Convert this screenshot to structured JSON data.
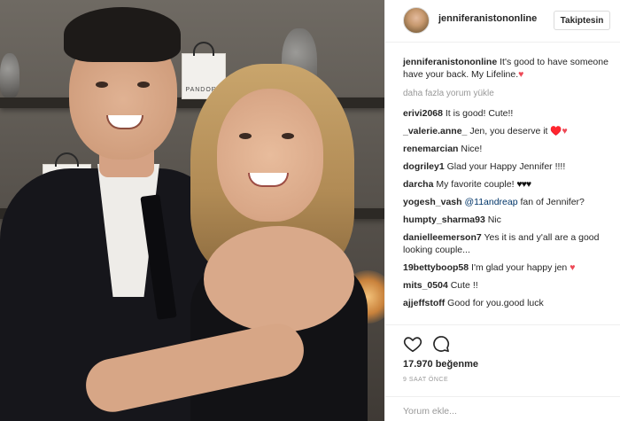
{
  "photo": {
    "alt": "",
    "bag_brand": "PANDORA"
  },
  "header": {
    "username": "jenniferanistononline",
    "follow_label": "Takiptesin"
  },
  "caption": {
    "username": "jenniferanistononline",
    "text": "It's good to have someone have your back. My Lifeline.",
    "emoji": "♥"
  },
  "load_more": "daha fazla yorum yükle",
  "comments": [
    {
      "user": "erivi2068",
      "text": "It is good! Cute!!"
    },
    {
      "user": "_valerie.anne_",
      "text": "Jen, you deserve it",
      "emoji": "♥️♥"
    },
    {
      "user": "renemarcian",
      "text": "Nice!"
    },
    {
      "user": "dogriley1",
      "text": "Glad your Happy Jennifer !!!!"
    },
    {
      "user": "darcha",
      "text": "My favorite couple!",
      "emoji": "♥♥♥"
    },
    {
      "user": "yogesh_vash",
      "mention": "@11andreap",
      "text": "fan of Jennifer?"
    },
    {
      "user": "humpty_sharma93",
      "text": "Nic"
    },
    {
      "user": "danielleemerson7",
      "text": "Yes it is and y'all are a good looking couple..."
    },
    {
      "user": "19bettyboop58",
      "text": "I'm glad your happy jen",
      "emoji": "♥"
    },
    {
      "user": "mits_0504",
      "text": "Cute !!"
    },
    {
      "user": "ajjeffstoff",
      "text": "Good for you.good luck"
    }
  ],
  "actions": {
    "like_icon": "heart-outline-icon",
    "comment_icon": "comment-bubble-icon",
    "likes": "17.970 beğenme",
    "timestamp": "9 SAAT ÖNCE",
    "comment_placeholder": "Yorum ekle..."
  },
  "colors": {
    "link": "#003569",
    "muted": "#999999",
    "heart": "#ed4956",
    "border": "#efefef"
  }
}
